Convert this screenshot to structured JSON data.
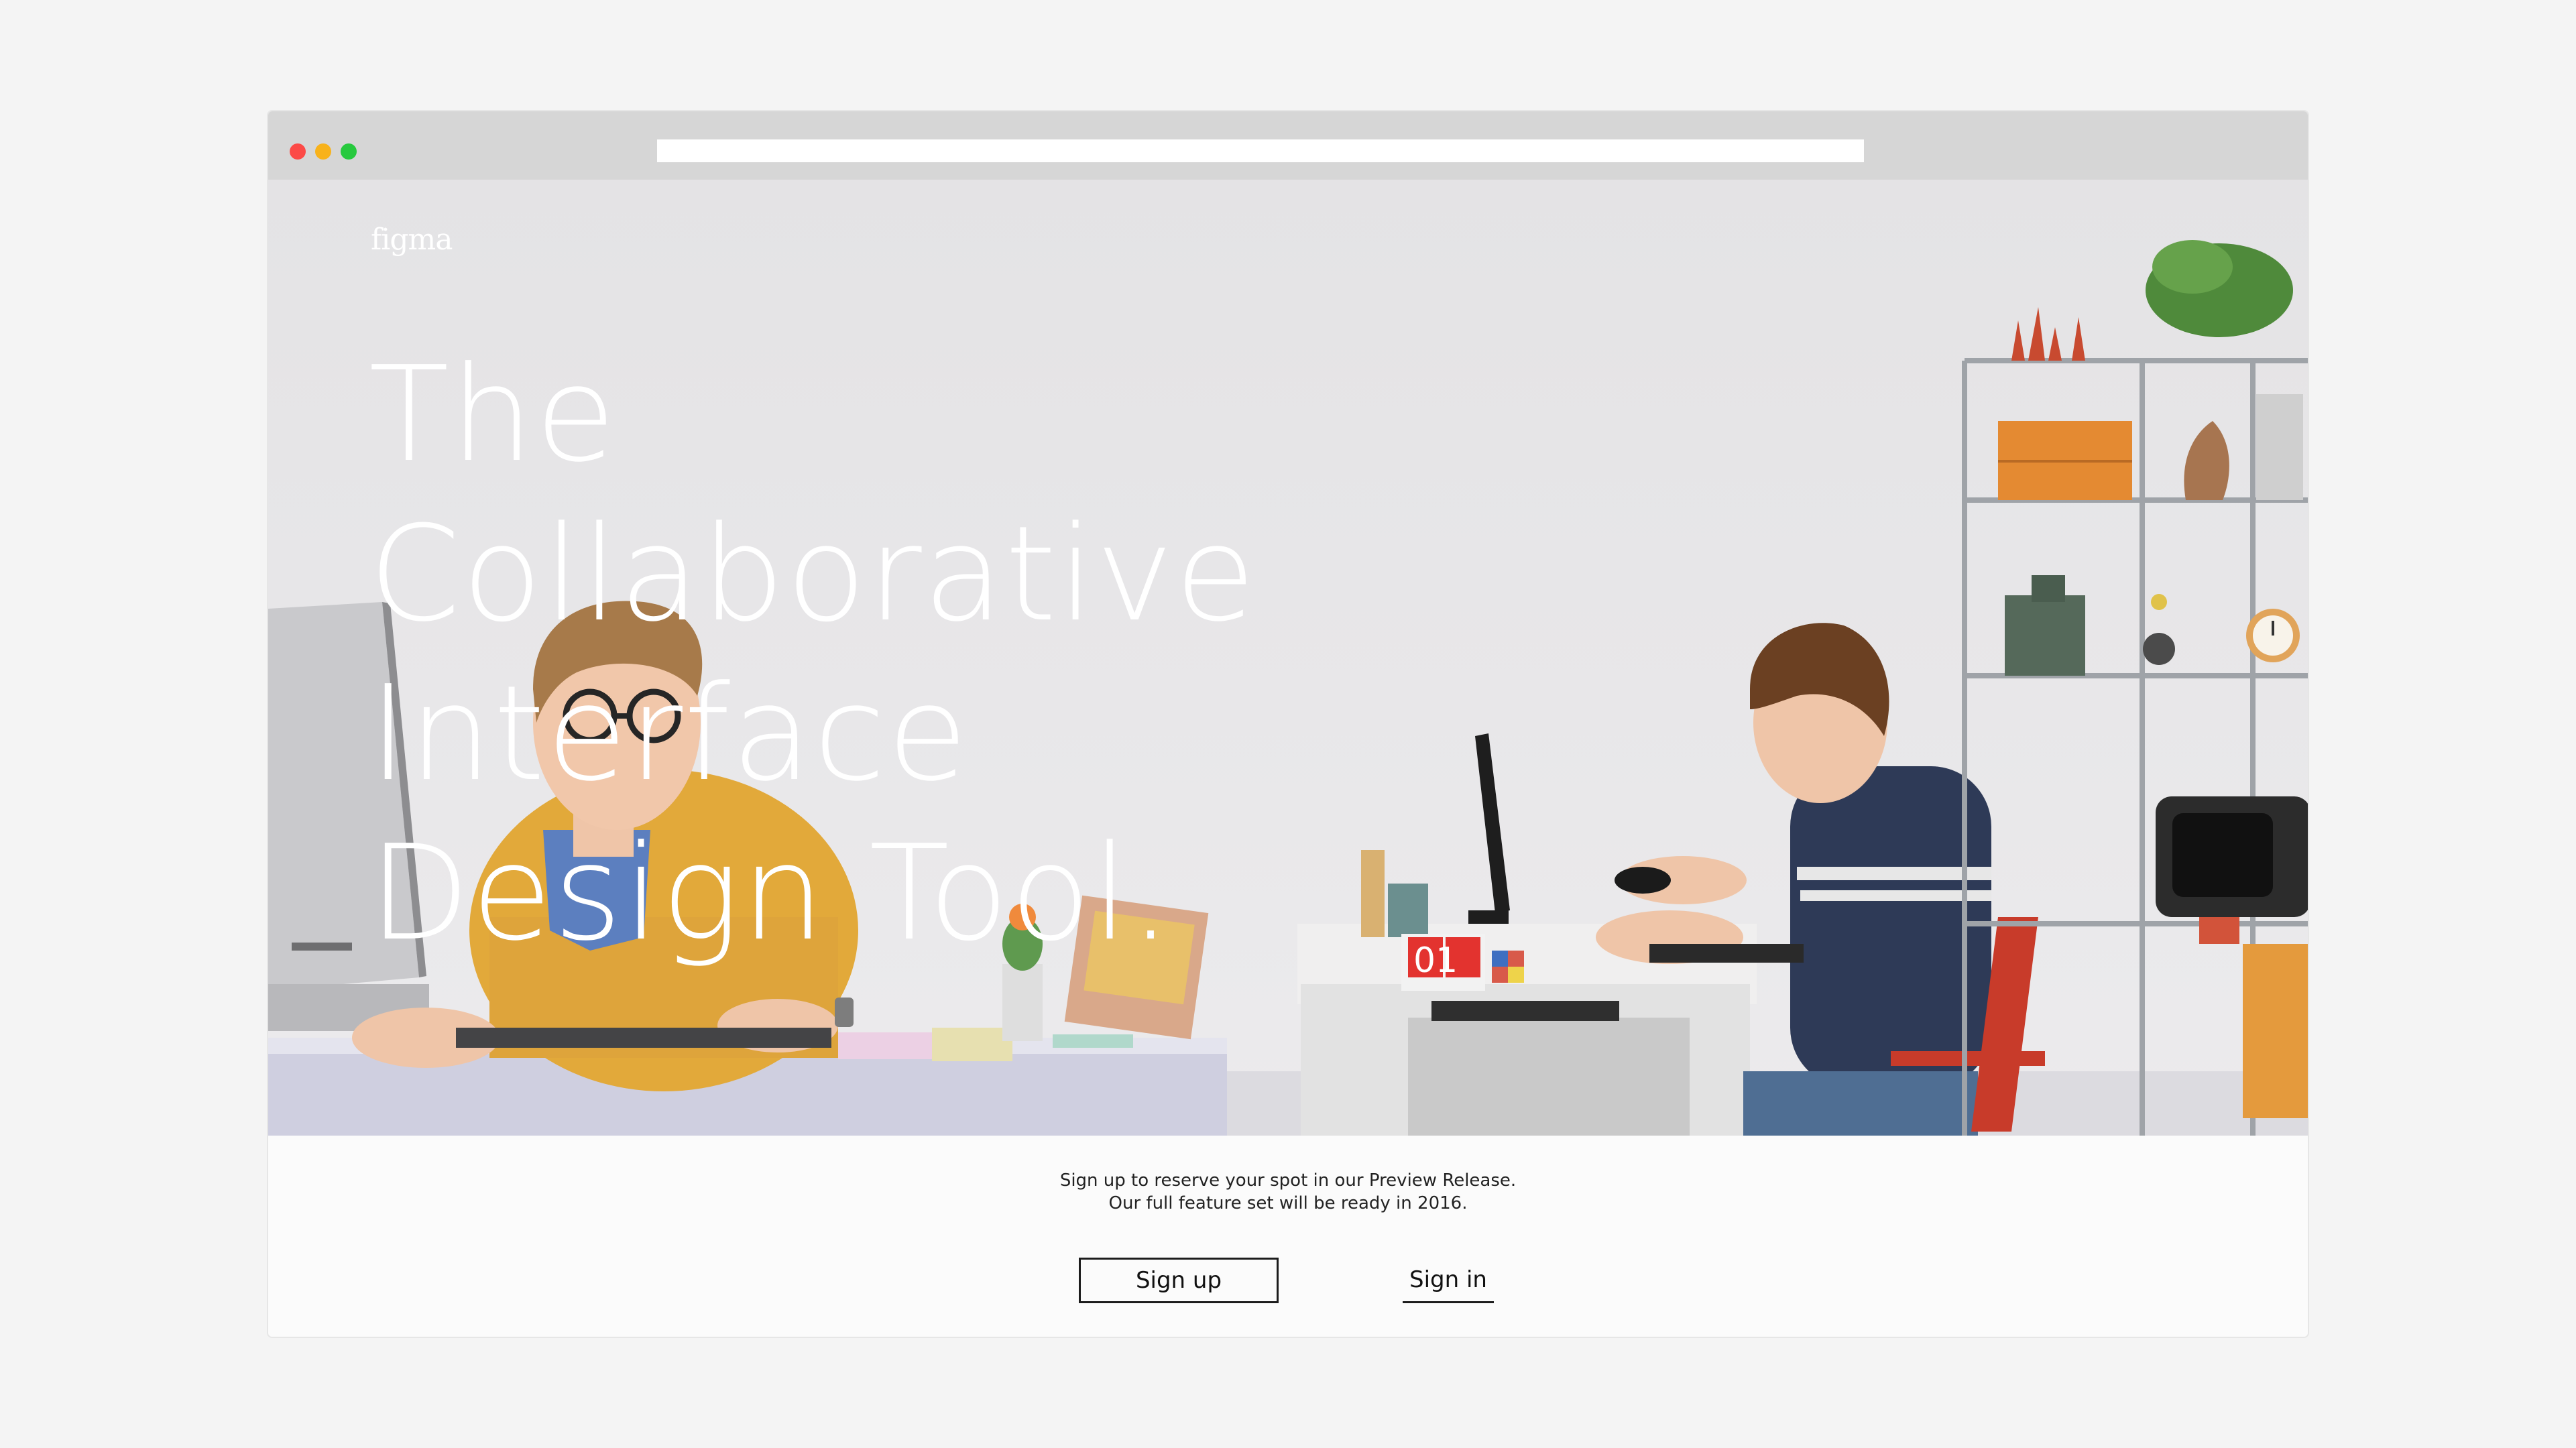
{
  "window": {
    "controls": [
      "close",
      "minimize",
      "maximize"
    ],
    "address_bar_value": ""
  },
  "hero": {
    "logo": "figma",
    "headline_lines": [
      "The",
      "Collaborative",
      "Interface",
      "Design Tool."
    ],
    "calendar_digits": "01"
  },
  "signup": {
    "line1": "Sign up to reserve your spot in our Preview Release.",
    "line2": "Our full feature set will be ready in 2016.",
    "signup_label": "Sign up",
    "signin_label": "Sign in"
  },
  "colors": {
    "page_bg": "#f4f4f4",
    "titlebar": "#d6d6d6",
    "close": "#fc4a47",
    "minimize": "#f8b21b",
    "maximize": "#27c93e",
    "hero_text": "#ffffff"
  }
}
